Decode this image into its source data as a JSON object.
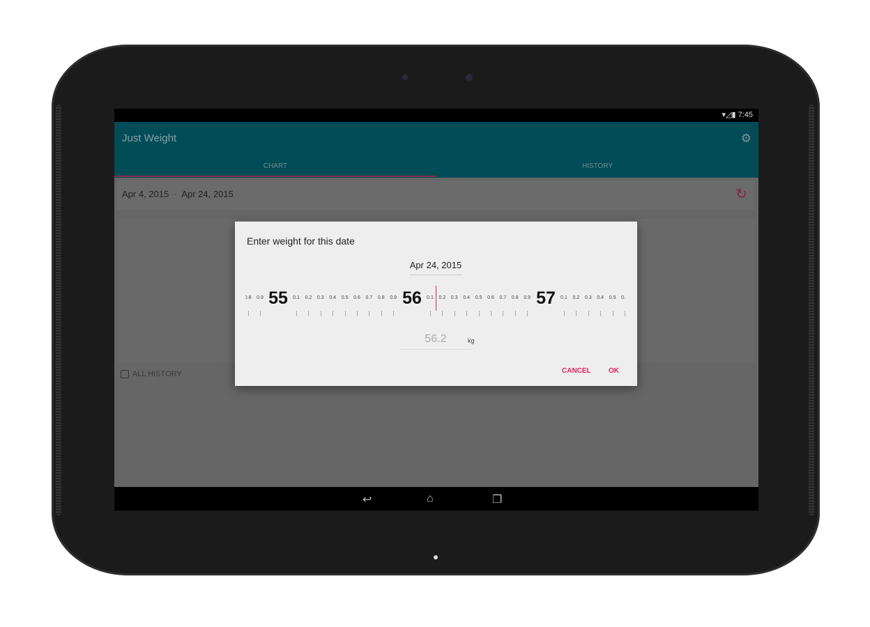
{
  "status": {
    "time": "7:45",
    "icons": [
      "wifi-icon",
      "signal-icon",
      "battery-icon"
    ]
  },
  "app": {
    "title": "Just Weight",
    "settings_icon": "gear-icon"
  },
  "tabs": [
    {
      "label": "CHART",
      "active": true
    },
    {
      "label": "HISTORY",
      "active": false
    }
  ],
  "date_range": {
    "start": "Apr 4, 2015",
    "separator": "-",
    "end": "Apr 24, 2015",
    "refresh_icon": "refresh-icon"
  },
  "all_history": {
    "label": "ALL HISTORY",
    "checked": false
  },
  "dialog": {
    "title": "Enter weight for this date",
    "date": "Apr 24, 2015",
    "ruler": {
      "major": [
        "55",
        "56",
        "57"
      ],
      "minor": [
        "0.1",
        "0.2",
        "0.3",
        "0.4",
        "0.5",
        "0.6",
        "0.7",
        "0.8",
        "0.9"
      ],
      "selected": 56.2
    },
    "value": "56.2",
    "unit": "kg",
    "cancel": "CANCEL",
    "ok": "OK"
  },
  "colors": {
    "accent": "#e91e63",
    "toolbar": "#014c56"
  }
}
